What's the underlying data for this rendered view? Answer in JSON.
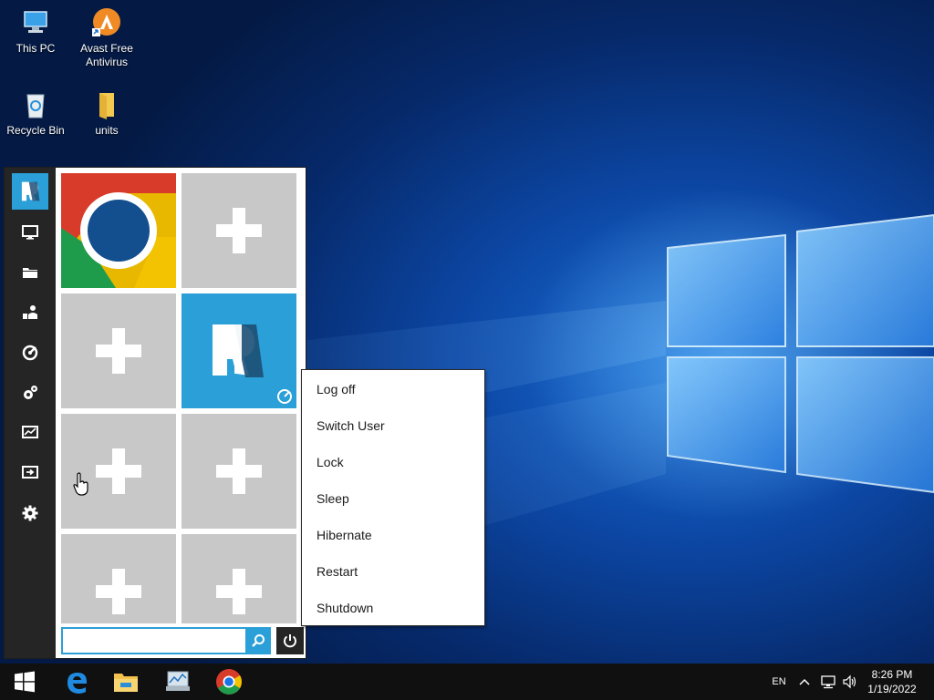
{
  "desktop": {
    "icons": [
      {
        "label": "This PC",
        "icon": "this-pc-icon"
      },
      {
        "label": "Avast Free Antivirus",
        "icon": "avast-icon"
      },
      {
        "label": "Recycle Bin",
        "icon": "recycle-bin-icon"
      },
      {
        "label": "units",
        "icon": "folder-icon"
      }
    ]
  },
  "launcher": {
    "rail": [
      {
        "icon": "app-logo-icon"
      },
      {
        "icon": "computer-icon"
      },
      {
        "icon": "folder-icon"
      },
      {
        "icon": "user-icon"
      },
      {
        "icon": "control-panel-icon"
      },
      {
        "icon": "settings-gears-icon"
      },
      {
        "icon": "performance-icon"
      },
      {
        "icon": "run-icon"
      },
      {
        "icon": "settings-gear-icon"
      }
    ],
    "tiles": [
      {
        "type": "app",
        "icon": "chrome-icon"
      },
      {
        "type": "add",
        "icon": "plus-icon"
      },
      {
        "type": "add",
        "icon": "plus-icon"
      },
      {
        "type": "app",
        "icon": "app-logo-icon"
      },
      {
        "type": "add",
        "icon": "plus-icon"
      },
      {
        "type": "add",
        "icon": "plus-icon"
      },
      {
        "type": "add",
        "icon": "plus-icon"
      },
      {
        "type": "add",
        "icon": "plus-icon"
      }
    ],
    "search": {
      "value": "",
      "placeholder": ""
    },
    "colors": {
      "accent": "#2a9fd8",
      "rail": "#252525",
      "tile_empty": "#c8c8c8",
      "tile_app": "#2a9fd8"
    }
  },
  "power_menu": {
    "items": [
      "Log off",
      "Switch User",
      "Lock",
      "Sleep",
      "Hibernate",
      "Restart",
      "Shutdown"
    ]
  },
  "taskbar": {
    "pinned": [
      {
        "icon": "start-windows-icon"
      },
      {
        "icon": "edge-icon"
      },
      {
        "icon": "file-explorer-icon"
      },
      {
        "icon": "resource-monitor-icon"
      },
      {
        "icon": "chrome-icon"
      }
    ],
    "tray": {
      "language": "EN",
      "icons": [
        "chevron-up-icon",
        "network-icon",
        "volume-icon"
      ]
    },
    "clock": {
      "time": "8:26 PM",
      "date": "1/19/2022"
    }
  }
}
